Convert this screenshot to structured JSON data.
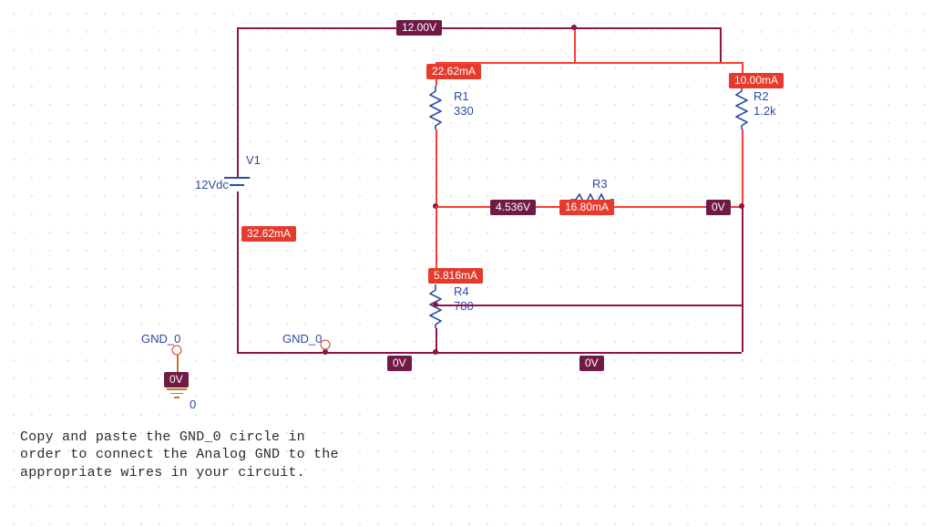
{
  "colors": {
    "wire": "#8d1549",
    "selected": "#ff3b30",
    "label": "#2a4aa6",
    "voltChip": "#6f1b46",
    "ampsChip": "#e63b2c"
  },
  "nodes": {
    "top": {
      "v": "12.00V"
    },
    "midLeft": {
      "v": "4.536V"
    },
    "midRight": {
      "v": "0V"
    },
    "bottom": {
      "v": "0V",
      "v2": "0V"
    },
    "floating": {
      "v": "0V"
    }
  },
  "source": {
    "V1": {
      "ref": "V1",
      "value": "12Vdc",
      "i": "32.62mA"
    }
  },
  "res": {
    "R1": {
      "ref": "R1",
      "value": "330",
      "i": "22.62mA"
    },
    "R2": {
      "ref": "R2",
      "value": "1.2k",
      "i": "10.00mA"
    },
    "R3": {
      "ref": "R3",
      "i": "16.80mA"
    },
    "R4": {
      "ref": "R4",
      "value": "780",
      "i": "5.816mA"
    }
  },
  "gnd": {
    "label": "GND_0"
  },
  "gndSym": {
    "title": "GND_0",
    "zero": "0"
  },
  "instruction": "Copy and paste the GND_0 circle in\norder to connect the Analog GND to the\nappropriate wires in your circuit."
}
